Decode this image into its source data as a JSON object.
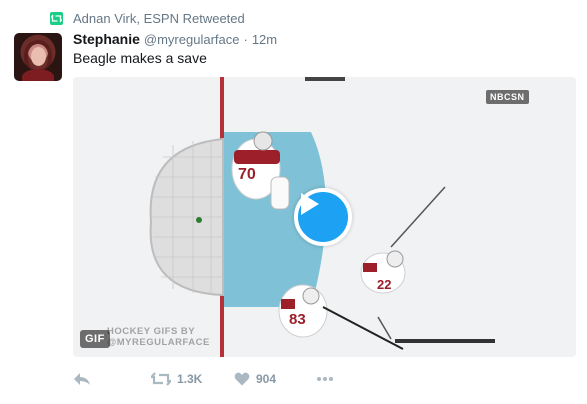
{
  "context": {
    "text": "Adnan Virk, ESPN Retweeted",
    "icon": "retweet-icon"
  },
  "tweet": {
    "display_name": "Stephanie",
    "username": "@myregularface",
    "separator": "·",
    "time": "12m",
    "text": "Beagle makes a save"
  },
  "media": {
    "type_badge": "GIF",
    "watermark": "HOCKEY GIFS BY\n@MYREGULARFACE",
    "network_logo": "NBCSN",
    "player_numbers": [
      "70",
      "83",
      "22"
    ],
    "play_icon": "play-icon"
  },
  "actions": {
    "reply_icon": "reply-icon",
    "retweet_count": "1.3K",
    "like_count": "904",
    "more_icon": "more-icon"
  },
  "colors": {
    "accent": "#1da1f2",
    "retweet_green": "#19cf86",
    "muted": "#657786",
    "icon_gray": "#aab8c2"
  }
}
